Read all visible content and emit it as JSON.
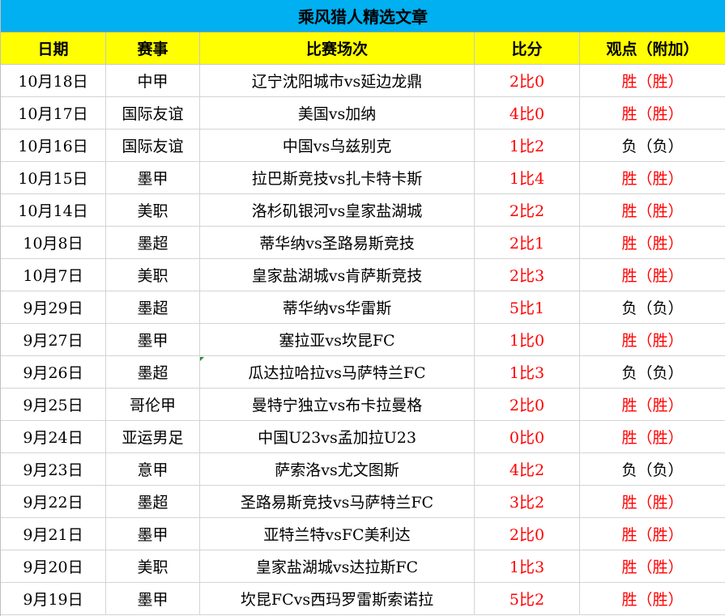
{
  "title": "乘风猎人精选文章",
  "headers": [
    "日期",
    "赛事",
    "比赛场次",
    "比分",
    "观点（附加）"
  ],
  "colors": {
    "title_bg": "#00b0f0",
    "header_bg": "#ffff00",
    "win": "#ff0000",
    "loss": "#000000"
  },
  "rows": [
    {
      "date": "10月18日",
      "league": "中甲",
      "match": "辽宁沈阳城市vs延边龙鼎",
      "score": "2比0",
      "view": "胜（胜）",
      "score_status": "red",
      "view_status": "red"
    },
    {
      "date": "10月17日",
      "league": "国际友谊",
      "match": "美国vs加纳",
      "score": "4比0",
      "view": "胜（胜）",
      "score_status": "red",
      "view_status": "red"
    },
    {
      "date": "10月16日",
      "league": "国际友谊",
      "match": "中国vs乌兹别克",
      "score": "1比2",
      "view": "负（负）",
      "score_status": "red",
      "view_status": "dark"
    },
    {
      "date": "10月15日",
      "league": "墨甲",
      "match": "拉巴斯竞技vs扎卡特卡斯",
      "score": "1比4",
      "view": "胜（胜）",
      "score_status": "red",
      "view_status": "red"
    },
    {
      "date": "10月14日",
      "league": "美职",
      "match": "洛杉矶银河vs皇家盐湖城",
      "score": "2比2",
      "view": "胜（胜）",
      "score_status": "red",
      "view_status": "red"
    },
    {
      "date": "10月8日",
      "league": "墨超",
      "match": "蒂华纳vs圣路易斯竞技",
      "score": "2比1",
      "view": "胜（胜）",
      "score_status": "red",
      "view_status": "red"
    },
    {
      "date": "10月7日",
      "league": "美职",
      "match": "皇家盐湖城vs肯萨斯竞技",
      "score": "2比3",
      "view": "胜（胜）",
      "score_status": "red",
      "view_status": "red"
    },
    {
      "date": "9月29日",
      "league": "墨超",
      "match": "蒂华纳vs华雷斯",
      "score": "5比1",
      "view": "负（负）",
      "score_status": "red",
      "view_status": "dark"
    },
    {
      "date": "9月27日",
      "league": "墨甲",
      "match": "塞拉亚vs坎昆FC",
      "score": "1比0",
      "view": "胜（胜）",
      "score_status": "red",
      "view_status": "red"
    },
    {
      "date": "9月26日",
      "league": "墨超",
      "match": "瓜达拉哈拉vs马萨特兰FC",
      "score": "1比3",
      "view": "负（负）",
      "score_status": "red",
      "view_status": "dark"
    },
    {
      "date": "9月25日",
      "league": "哥伦甲",
      "match": "曼特宁独立vs布卡拉曼格",
      "score": "2比0",
      "view": "胜（胜）",
      "score_status": "red",
      "view_status": "red"
    },
    {
      "date": "9月24日",
      "league": "亚运男足",
      "match": "中国U23vs孟加拉U23",
      "score": "0比0",
      "view": "胜（胜）",
      "score_status": "red",
      "view_status": "red"
    },
    {
      "date": "9月23日",
      "league": "意甲",
      "match": "萨索洛vs尤文图斯",
      "score": "4比2",
      "view": "负（负）",
      "score_status": "red",
      "view_status": "dark"
    },
    {
      "date": "9月22日",
      "league": "墨超",
      "match": "圣路易斯竞技vs马萨特兰FC",
      "score": "3比2",
      "view": "胜（胜）",
      "score_status": "red",
      "view_status": "red"
    },
    {
      "date": "9月21日",
      "league": "墨甲",
      "match": "亚特兰特vsFC美利达",
      "score": "2比0",
      "view": "胜（胜）",
      "score_status": "red",
      "view_status": "red"
    },
    {
      "date": "9月20日",
      "league": "美职",
      "match": "皇家盐湖城vs达拉斯FC",
      "score": "1比3",
      "view": "胜（胜）",
      "score_status": "red",
      "view_status": "red"
    },
    {
      "date": "9月19日",
      "league": "墨甲",
      "match": "坎昆FCvs西玛罗雷斯索诺拉",
      "score": "5比2",
      "view": "胜（胜）",
      "score_status": "red",
      "view_status": "red"
    }
  ]
}
